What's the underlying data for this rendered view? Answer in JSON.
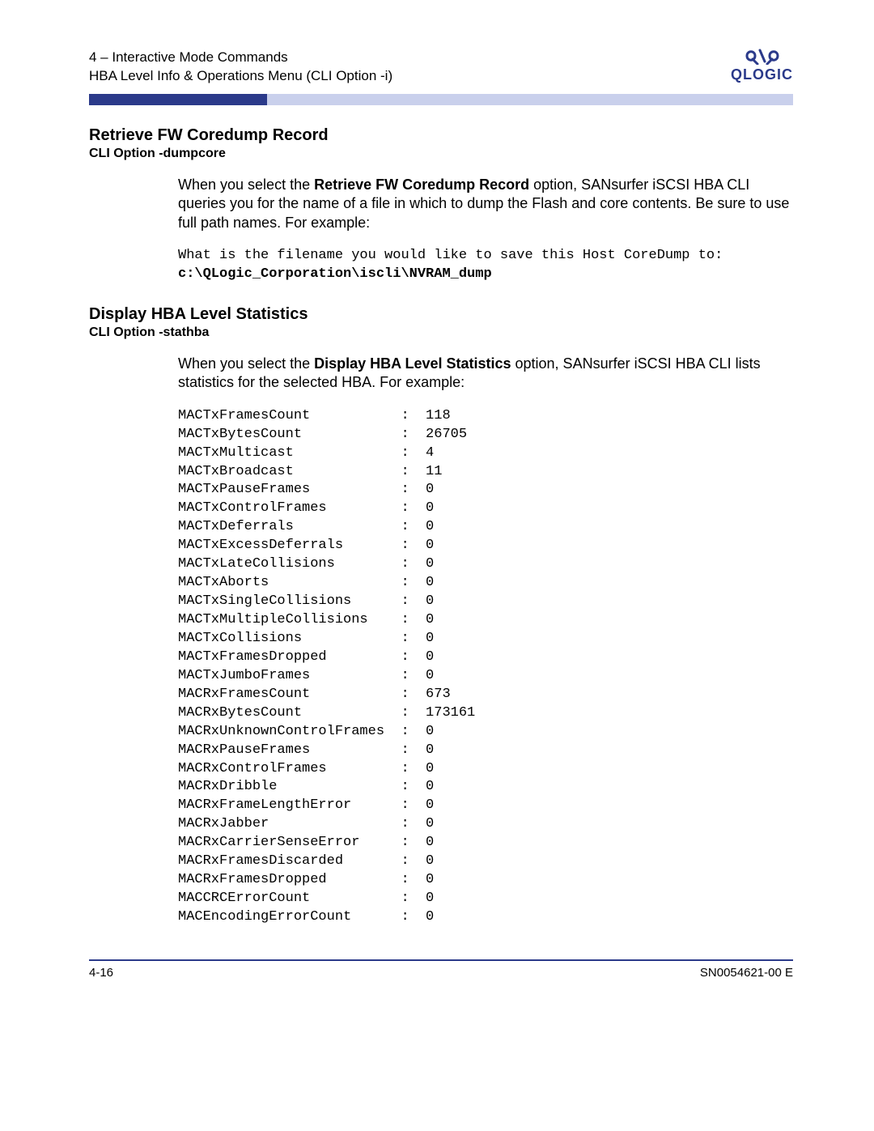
{
  "header": {
    "line1": "4 – Interactive Mode Commands",
    "line2": "HBA Level Info & Operations Menu (CLI Option -i)",
    "brand": "QLOGIC"
  },
  "section1": {
    "heading": "Retrieve FW Coredump Record",
    "cli_option": "CLI Option -dumpcore",
    "body_pre": "When you select the ",
    "body_bold": "Retrieve FW Coredump Record",
    "body_post": " option, SANsurfer iSCSI HBA CLI queries you for the name of a file in which to dump the Flash and core contents. Be sure to use full path names. For example:",
    "mono_line1": "What is the filename you would like to save this Host CoreDump to:",
    "mono_line2": "c:\\QLogic_Corporation\\iscli\\NVRAM_dump"
  },
  "section2": {
    "heading": "Display HBA Level Statistics",
    "cli_option": "CLI Option -stathba",
    "body_pre": "When you select the ",
    "body_bold": "Display HBA Level Statistics",
    "body_post": " option, SANsurfer iSCSI HBA CLI lists statistics for the selected HBA. For example:",
    "stats": [
      {
        "label": "MACTxFramesCount",
        "value": "118"
      },
      {
        "label": "MACTxBytesCount",
        "value": "26705"
      },
      {
        "label": "MACTxMulticast",
        "value": "4"
      },
      {
        "label": "MACTxBroadcast",
        "value": "11"
      },
      {
        "label": "MACTxPauseFrames",
        "value": "0"
      },
      {
        "label": "MACTxControlFrames",
        "value": "0"
      },
      {
        "label": "MACTxDeferrals",
        "value": "0"
      },
      {
        "label": "MACTxExcessDeferrals",
        "value": "0"
      },
      {
        "label": "MACTxLateCollisions",
        "value": "0"
      },
      {
        "label": "MACTxAborts",
        "value": "0"
      },
      {
        "label": "MACTxSingleCollisions",
        "value": "0"
      },
      {
        "label": "MACTxMultipleCollisions",
        "value": "0"
      },
      {
        "label": "MACTxCollisions",
        "value": "0"
      },
      {
        "label": "MACTxFramesDropped",
        "value": "0"
      },
      {
        "label": "MACTxJumboFrames",
        "value": "0"
      },
      {
        "label": "MACRxFramesCount",
        "value": "673"
      },
      {
        "label": "MACRxBytesCount",
        "value": "173161"
      },
      {
        "label": "MACRxUnknownControlFrames",
        "value": "0"
      },
      {
        "label": "MACRxPauseFrames",
        "value": "0"
      },
      {
        "label": "MACRxControlFrames",
        "value": "0"
      },
      {
        "label": "MACRxDribble",
        "value": "0"
      },
      {
        "label": "MACRxFrameLengthError",
        "value": "0"
      },
      {
        "label": "MACRxJabber",
        "value": "0"
      },
      {
        "label": "MACRxCarrierSenseError",
        "value": "0"
      },
      {
        "label": "MACRxFramesDiscarded",
        "value": "0"
      },
      {
        "label": "MACRxFramesDropped",
        "value": "0"
      },
      {
        "label": "MACCRCErrorCount",
        "value": "0"
      },
      {
        "label": "MACEncodingErrorCount",
        "value": "0"
      }
    ]
  },
  "footer": {
    "page": "4-16",
    "doc": "SN0054621-00  E"
  }
}
